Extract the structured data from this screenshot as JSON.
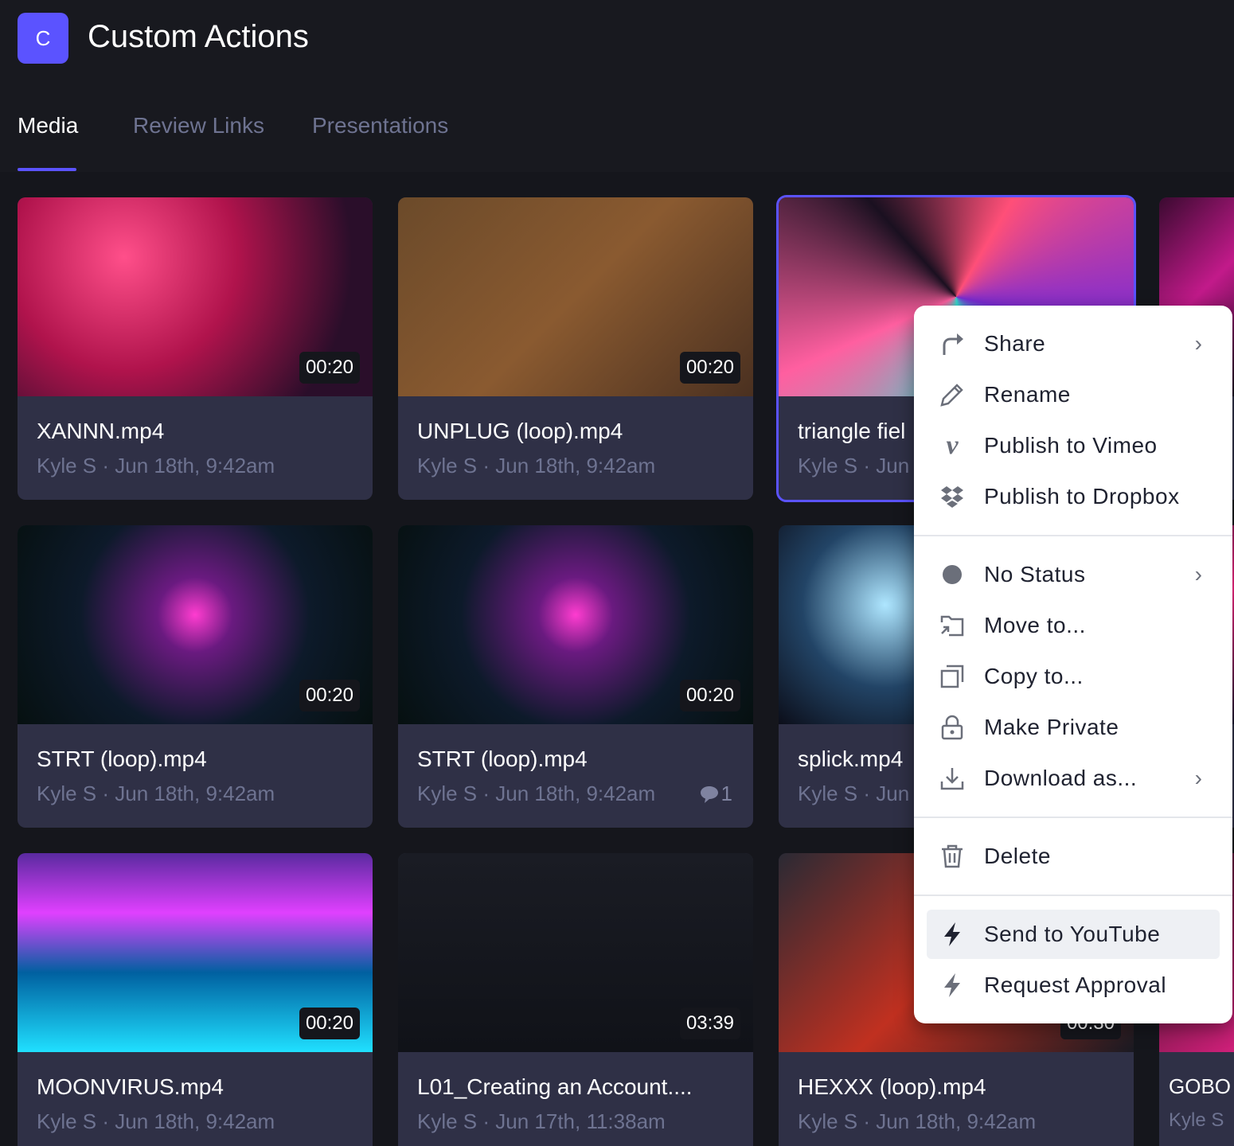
{
  "header": {
    "logo_letter": "C",
    "title": "Custom Actions"
  },
  "tabs": [
    {
      "label": "Media",
      "active": true
    },
    {
      "label": "Review Links"
    },
    {
      "label": "Presentations"
    }
  ],
  "accent": "#5b53ff",
  "cards": [
    {
      "name": "XANNN.mp4",
      "meta": "Kyle S · Jun 18th, 9:42am",
      "duration": "00:20"
    },
    {
      "name": "UNPLUG (loop).mp4",
      "meta": "Kyle S · Jun 18th, 9:42am",
      "duration": "00:20"
    },
    {
      "name": "triangle fiel",
      "meta": "Kyle S · Jun",
      "duration": ""
    },
    {
      "name": "",
      "meta": "",
      "duration": ""
    },
    {
      "name": "STRT (loop).mp4",
      "meta": "Kyle S · Jun 18th, 9:42am",
      "duration": "00:20"
    },
    {
      "name": "STRT (loop).mp4",
      "meta": "Kyle S · Jun 18th, 9:42am",
      "duration": "00:20",
      "comments": "1"
    },
    {
      "name": "splick.mp4",
      "meta": "Kyle S · Jun",
      "duration": ""
    },
    {
      "name": "",
      "meta": "",
      "duration": ""
    },
    {
      "name": "MOONVIRUS.mp4",
      "meta": "Kyle S · Jun 18th, 9:42am",
      "duration": "00:20"
    },
    {
      "name": "L01_Creating an Account....",
      "meta": "Kyle S · Jun 17th, 11:38am",
      "duration": "03:39"
    },
    {
      "name": "HEXXX (loop).mp4",
      "meta": "Kyle S · Jun 18th, 9:42am",
      "duration": "00:30"
    },
    {
      "name": "GOBO",
      "meta": "Kyle S",
      "duration": ""
    }
  ],
  "menu": {
    "share": "Share",
    "rename": "Rename",
    "vimeo": "Publish to Vimeo",
    "dropbox": "Publish to Dropbox",
    "status": "No Status",
    "move": "Move to...",
    "copy": "Copy to...",
    "private": "Make Private",
    "download": "Download as...",
    "delete": "Delete",
    "youtube": "Send to YouTube",
    "approval": "Request Approval"
  }
}
